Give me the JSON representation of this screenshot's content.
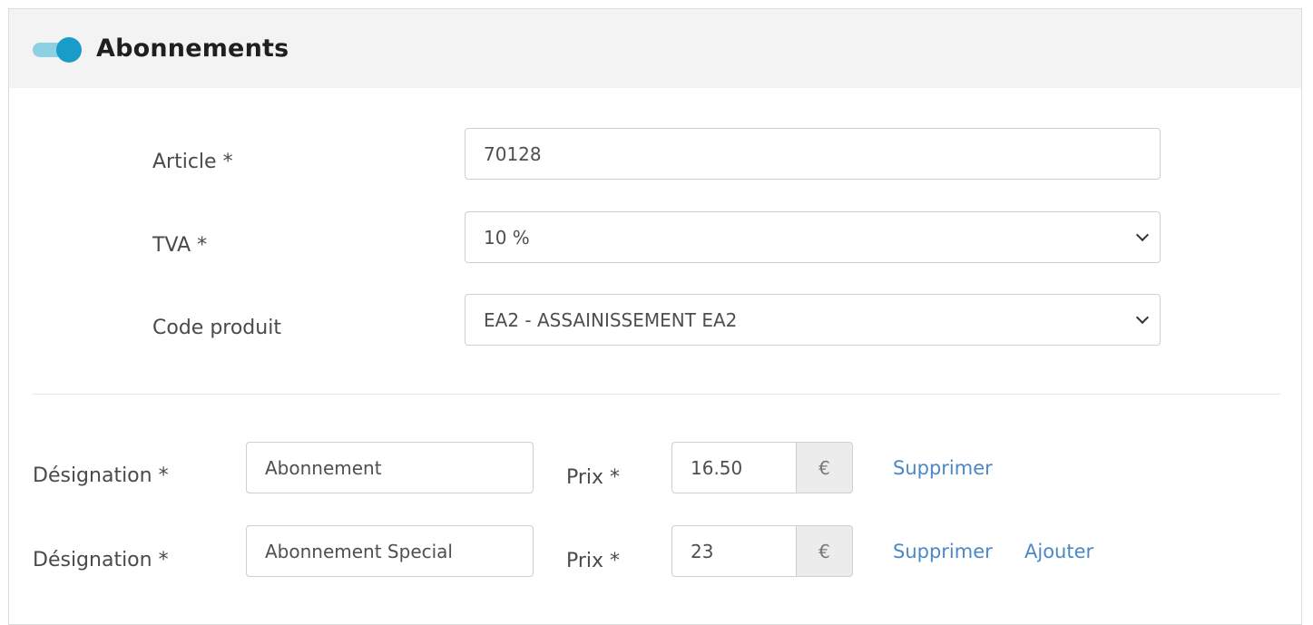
{
  "section": {
    "title": "Abonnements",
    "toggle_on": true,
    "accent_color": "#1a9cc9"
  },
  "form": {
    "article": {
      "label": "Article *",
      "value": "70128"
    },
    "tva": {
      "label": "TVA *",
      "value": "10 %"
    },
    "code_produit": {
      "label": "Code produit",
      "value": "EA2 - ASSAINISSEMENT EA2"
    }
  },
  "rows": [
    {
      "designation_label": "Désignation *",
      "designation_value": "Abonnement",
      "prix_label": "Prix *",
      "prix_value": "16.50",
      "currency": "€",
      "delete_label": "Supprimer"
    },
    {
      "designation_label": "Désignation *",
      "designation_value": "Abonnement Special",
      "prix_label": "Prix *",
      "prix_value": "23",
      "currency": "€",
      "delete_label": "Supprimer",
      "add_label": "Ajouter"
    }
  ]
}
